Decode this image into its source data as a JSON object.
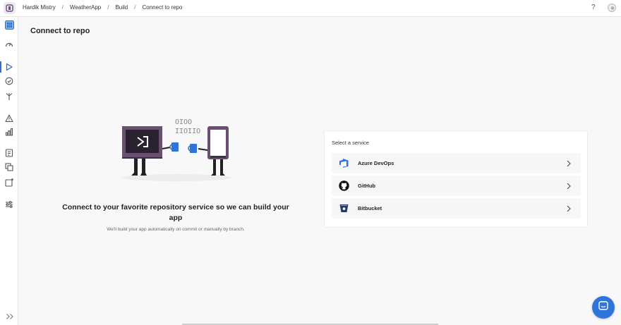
{
  "breadcrumb": {
    "user": "Hardik Mistry",
    "app": "WeatherApp",
    "section": "Build",
    "current": "Connect to repo"
  },
  "topbar": {
    "help_label": "?"
  },
  "sidebar": {
    "items": [
      {
        "icon": "apps-grid-icon"
      },
      {
        "icon": "dashboard-gauge-icon"
      },
      {
        "icon": "build-play-icon",
        "active": true
      },
      {
        "icon": "test-check-icon"
      },
      {
        "icon": "distribute-icon"
      },
      {
        "icon": "diagnostics-warning-icon"
      },
      {
        "icon": "analytics-bars-icon"
      },
      {
        "icon": "push-icon"
      },
      {
        "icon": "data-icon"
      },
      {
        "icon": "auth-icon"
      },
      {
        "icon": "settings-sliders-icon"
      }
    ]
  },
  "page": {
    "title": "Connect to repo",
    "headline": "Connect to your favorite repository service so we can build your app",
    "subline": "We'll build your app automatically on commit or manually by branch.",
    "illustration_code": "OIOO IIOIIO"
  },
  "services": {
    "label": "Select a service",
    "items": [
      {
        "name": "Azure DevOps",
        "icon": "azure-devops-icon"
      },
      {
        "name": "GitHub",
        "icon": "github-icon"
      },
      {
        "name": "Bitbucket",
        "icon": "bitbucket-icon"
      }
    ]
  },
  "colors": {
    "accent": "#2f74d9",
    "background": "#f8f8f8",
    "monitor": "#6b4f73"
  }
}
